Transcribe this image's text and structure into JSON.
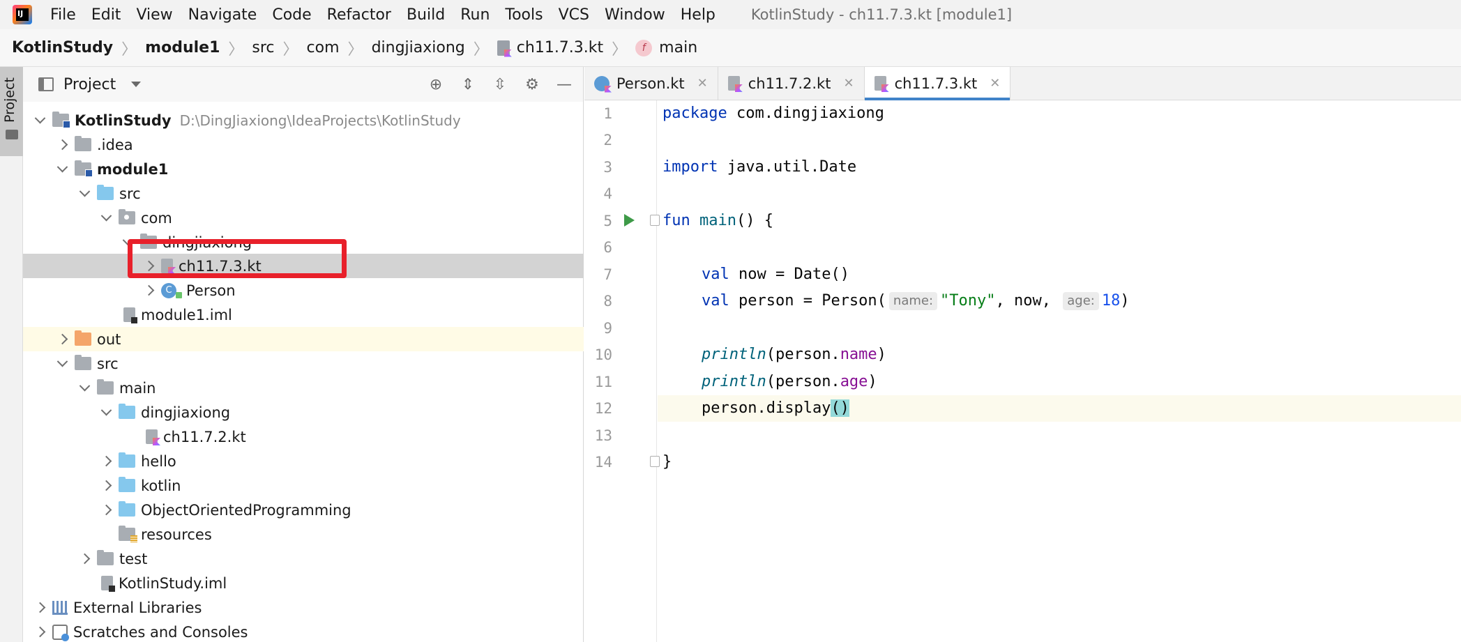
{
  "menubar": {
    "items": [
      "File",
      "Edit",
      "View",
      "Navigate",
      "Code",
      "Refactor",
      "Build",
      "Run",
      "Tools",
      "VCS",
      "Window",
      "Help"
    ],
    "window_title": "KotlinStudy - ch11.7.3.kt [module1]"
  },
  "breadcrumbs": [
    "KotlinStudy",
    "module1",
    "src",
    "com",
    "dingjiaxiong",
    "ch11.7.3.kt",
    "main"
  ],
  "tool_strip": {
    "project_tab": "Project"
  },
  "project_panel": {
    "title": "Project",
    "tree": [
      {
        "label": "KotlinStudy",
        "path": "D:\\DingJiaxiong\\IdeaProjects\\KotlinStudy"
      },
      {
        "label": ".idea"
      },
      {
        "label": "module1"
      },
      {
        "label": "src"
      },
      {
        "label": "com"
      },
      {
        "label": "dingjiaxiong"
      },
      {
        "label": "ch11.7.3.kt"
      },
      {
        "label": "Person"
      },
      {
        "label": "module1.iml"
      },
      {
        "label": "out"
      },
      {
        "label": "src"
      },
      {
        "label": "main"
      },
      {
        "label": "dingjiaxiong"
      },
      {
        "label": "ch11.7.2.kt"
      },
      {
        "label": "hello"
      },
      {
        "label": "kotlin"
      },
      {
        "label": "ObjectOrientedProgramming"
      },
      {
        "label": "resources"
      },
      {
        "label": "test"
      },
      {
        "label": "KotlinStudy.iml"
      },
      {
        "label": "External Libraries"
      },
      {
        "label": "Scratches and Consoles"
      }
    ]
  },
  "editor": {
    "tabs": [
      "Person.kt",
      "ch11.7.2.kt",
      "ch11.7.3.kt"
    ],
    "active_tab": "ch11.7.3.kt",
    "line_numbers": [
      "1",
      "2",
      "3",
      "4",
      "5",
      "6",
      "7",
      "8",
      "9",
      "10",
      "11",
      "12",
      "13",
      "14"
    ],
    "current_line": 12,
    "code": {
      "l1_kw": "package",
      "l1_rest": " com.dingjiaxiong",
      "l3_kw": "import",
      "l3_rest": " java.util.Date",
      "l5_kw": "fun",
      "l5_fn": "main",
      "l5_rest": "() {",
      "l7_kw": "val",
      "l7_rest": " now = Date()",
      "l8_kw": "val",
      "l8_a": " person = Person(",
      "l8_hint1": "name:",
      "l8_str": "\"Tony\"",
      "l8_b": ", now, ",
      "l8_hint2": "age:",
      "l8_num": "18",
      "l8_c": ")",
      "l10_fn": "println",
      "l10_a": "(person.",
      "l10_prop": "name",
      "l10_b": ")",
      "l11_fn": "println",
      "l11_a": "(person.",
      "l11_prop": "age",
      "l11_b": ")",
      "l12_a": "person.display",
      "l12_paren": "()",
      "l14": "}"
    }
  },
  "colors": {
    "keyword": "#0033b3",
    "string": "#067d17",
    "number": "#1750eb",
    "property": "#871094",
    "function": "#00627a",
    "annotation_box": "#e8202a",
    "active_tab_underline": "#4083c9"
  }
}
